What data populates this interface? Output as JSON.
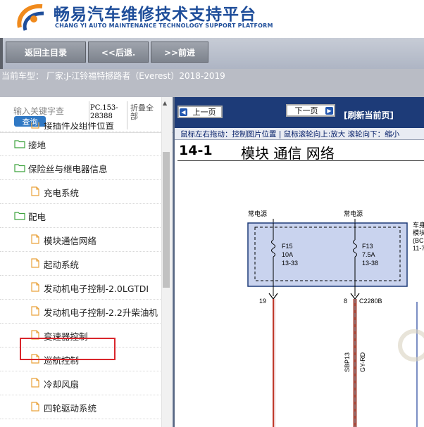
{
  "header": {
    "brand_cn": "畅易汽车维修技术支持平台",
    "brand_en": "CHANG YI AUTO MAINTENANCE TECHNOLOGY SUPPORT PLATFORM"
  },
  "nav": {
    "home": "返回主目录",
    "back": "<<后退.",
    "forward": ">>前进"
  },
  "car_info": "当前车型：  厂家:J-江铃福特撼路者（Everest）2018-2019",
  "sidebar": {
    "search_placeholder": "输入关键字查",
    "search_button": "查询",
    "code_line1": "PC.153-",
    "code_line2": "28388",
    "fold_label": "折叠全部",
    "partial_item": "接插件及组件位置",
    "items": [
      {
        "label": "接地",
        "type": "folder"
      },
      {
        "label": "保险丝与继电器信息",
        "type": "folder"
      },
      {
        "label": "充电系统",
        "type": "page"
      },
      {
        "label": "配电",
        "type": "folder"
      },
      {
        "label": "模块通信网络",
        "type": "page"
      },
      {
        "label": "起动系统",
        "type": "page"
      },
      {
        "label": "发动机电子控制-2.0LGTDI",
        "type": "page"
      },
      {
        "label": "发动机电子控制-2.2升柴油机",
        "type": "page"
      },
      {
        "label": "变速器控制",
        "type": "page"
      },
      {
        "label": "巡航控制",
        "type": "page"
      },
      {
        "label": "冷却风扇",
        "type": "page"
      },
      {
        "label": "四轮驱动系统",
        "type": "page"
      }
    ]
  },
  "viewer": {
    "prev": "上一页",
    "next": "下一页",
    "refresh": "[刷新当前页]",
    "hint": "鼠标左右拖动：控制图片位置 | 鼠标滚轮向上:放大  滚轮向下：缩小",
    "doc_number": "14-1",
    "doc_title": "模块 通信 网络"
  },
  "diagram": {
    "source_label_1": "常电源",
    "source_label_2": "常电源",
    "fuse1": {
      "id": "F15",
      "rating": "10A",
      "ref": "13-33"
    },
    "fuse2": {
      "id": "F13",
      "rating": "7.5A",
      "ref": "13-38"
    },
    "box_label_1": "车身",
    "box_label_2": "模块",
    "box_label_3": "(BC",
    "box_label_4": "11-7",
    "pin1": "19",
    "pin2": "8",
    "connector": "C2280B",
    "wire1": "SBP13",
    "wire2": "GY-RD"
  },
  "colors": {
    "brand_blue": "#1f4e9a",
    "viewer_header": "#1d3b78",
    "highlight_red": "#d9262c",
    "folder_green": "#3fa33f",
    "page_orange": "#e9a23b",
    "wire_red": "#c0392b",
    "module_fill": "#c9d3ee"
  }
}
